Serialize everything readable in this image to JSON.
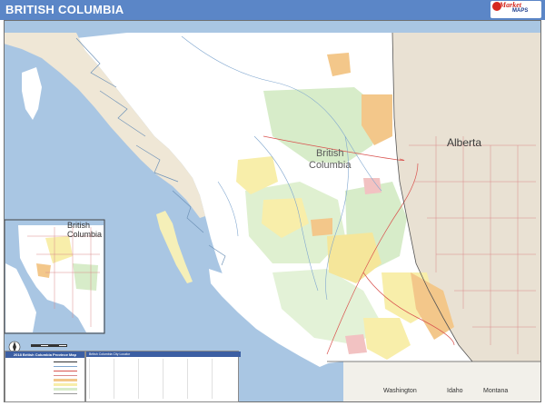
{
  "header": {
    "title": "BRITISH COLUMBIA",
    "background": "#5b86c7"
  },
  "logo": {
    "line1": "Market",
    "line2": "MAPS"
  },
  "map": {
    "region_label": "British\nColumbia",
    "neighbor_label": "Alberta",
    "inset_label": "British\nColumbia",
    "south_labels": [
      "Washington",
      "Idaho",
      "Montana"
    ],
    "colors": {
      "water": "#a9c6e3",
      "land": "#ffffff",
      "alberta": "#e9e1d3",
      "forest": "#d7ecc9",
      "zone_yellow": "#f8eeaa",
      "zone_orange": "#f3c78a",
      "zone_pink": "#f2c2c2",
      "roads": "#d98a8a"
    }
  },
  "legend": {
    "title": "2018 British Columbia Province Map",
    "rows": [
      "",
      "",
      "",
      "",
      "",
      "",
      "",
      ""
    ]
  },
  "index": {
    "title": "British Columbia City Locator"
  },
  "icons": [
    "compass-icon",
    "scale-bar-icon"
  ]
}
